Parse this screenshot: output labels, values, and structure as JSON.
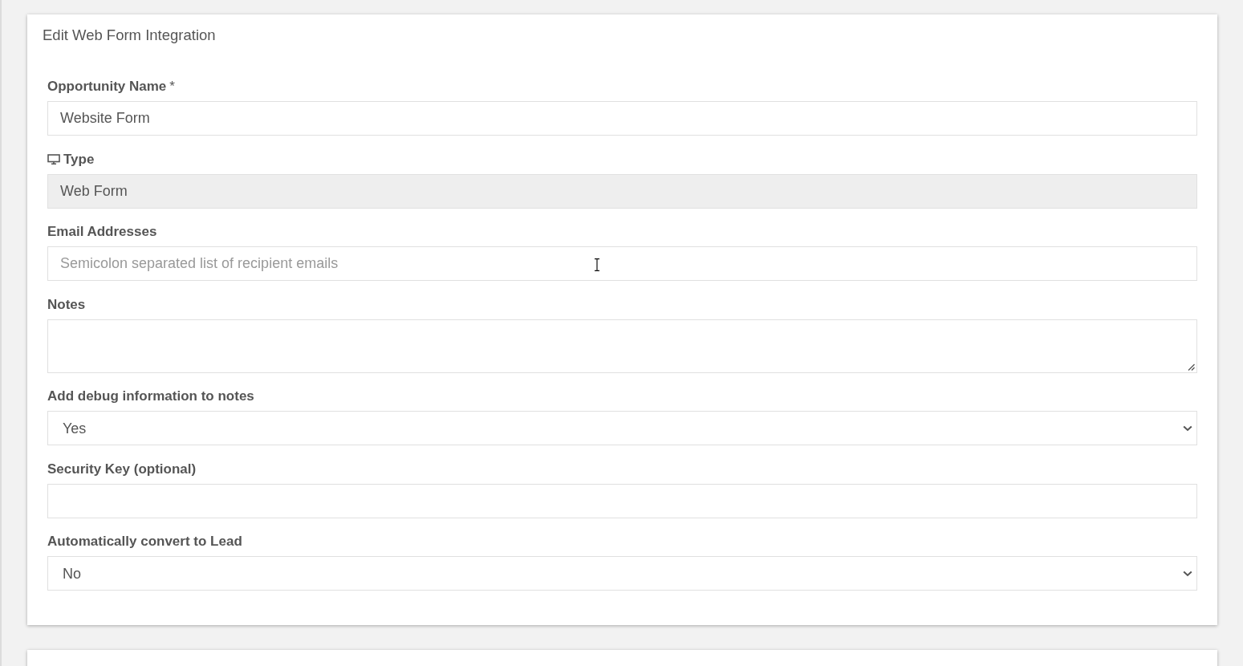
{
  "form": {
    "title": "Edit Web Form Integration",
    "fields": [
      {
        "kind": "text",
        "label": "Opportunity Name",
        "required_mark": "*",
        "value": "Website Form",
        "hovered": false
      },
      {
        "kind": "device-type",
        "label": "Type",
        "value": "Web Form",
        "hovered": false
      },
      {
        "kind": "text",
        "label": "Email Addresses",
        "placeholder": "Semicolon separated list of recipient emails",
        "hovered": true
      },
      {
        "kind": "textarea",
        "label": "Notes",
        "hovered": false
      },
      {
        "kind": "select",
        "label": "Add debug information to notes",
        "value": "Yes",
        "hovered": false
      },
      {
        "kind": "text",
        "label": "Security Key (optional)",
        "hovered": false
      },
      {
        "kind": "select",
        "label": "Automatically convert to Lead",
        "value": "No",
        "hovered": false
      }
    ]
  }
}
